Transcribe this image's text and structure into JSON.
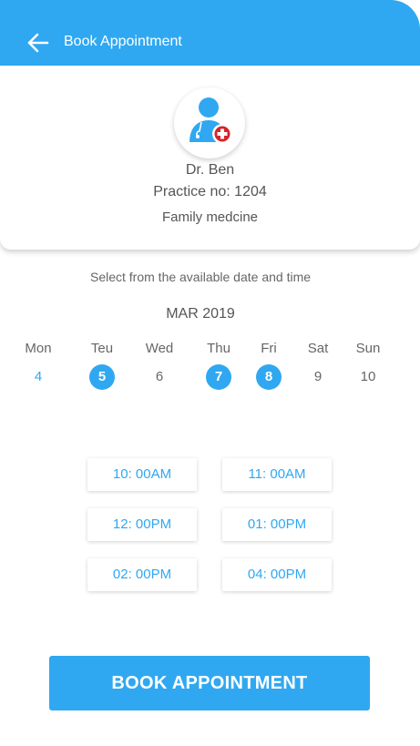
{
  "header": {
    "title": "Book Appointment",
    "back_icon": "arrow-left-icon",
    "color": "#2fa8f1"
  },
  "doctor": {
    "avatar_icon": "doctor-medical-icon",
    "name": "Dr. Ben",
    "practice": "Practice no: 1204",
    "specialty": "Family medcine"
  },
  "schedule": {
    "instruction": "Select from the available date and time",
    "month": "MAR 2019",
    "days": [
      {
        "name": "Mon",
        "date": "4",
        "state": "today"
      },
      {
        "name": "Teu",
        "date": "5",
        "state": "available"
      },
      {
        "name": "Wed",
        "date": "6",
        "state": "normal"
      },
      {
        "name": "Thu",
        "date": "7",
        "state": "available"
      },
      {
        "name": "Fri",
        "date": "8",
        "state": "available"
      },
      {
        "name": "Sat",
        "date": "9",
        "state": "normal"
      },
      {
        "name": "Sun",
        "date": "10",
        "state": "normal"
      }
    ],
    "slots": [
      "10: 00AM",
      "11: 00AM",
      "12: 00PM",
      "01: 00PM",
      "02: 00PM",
      "04: 00PM"
    ]
  },
  "actions": {
    "book_label": "BOOK APPOINTMENT"
  }
}
